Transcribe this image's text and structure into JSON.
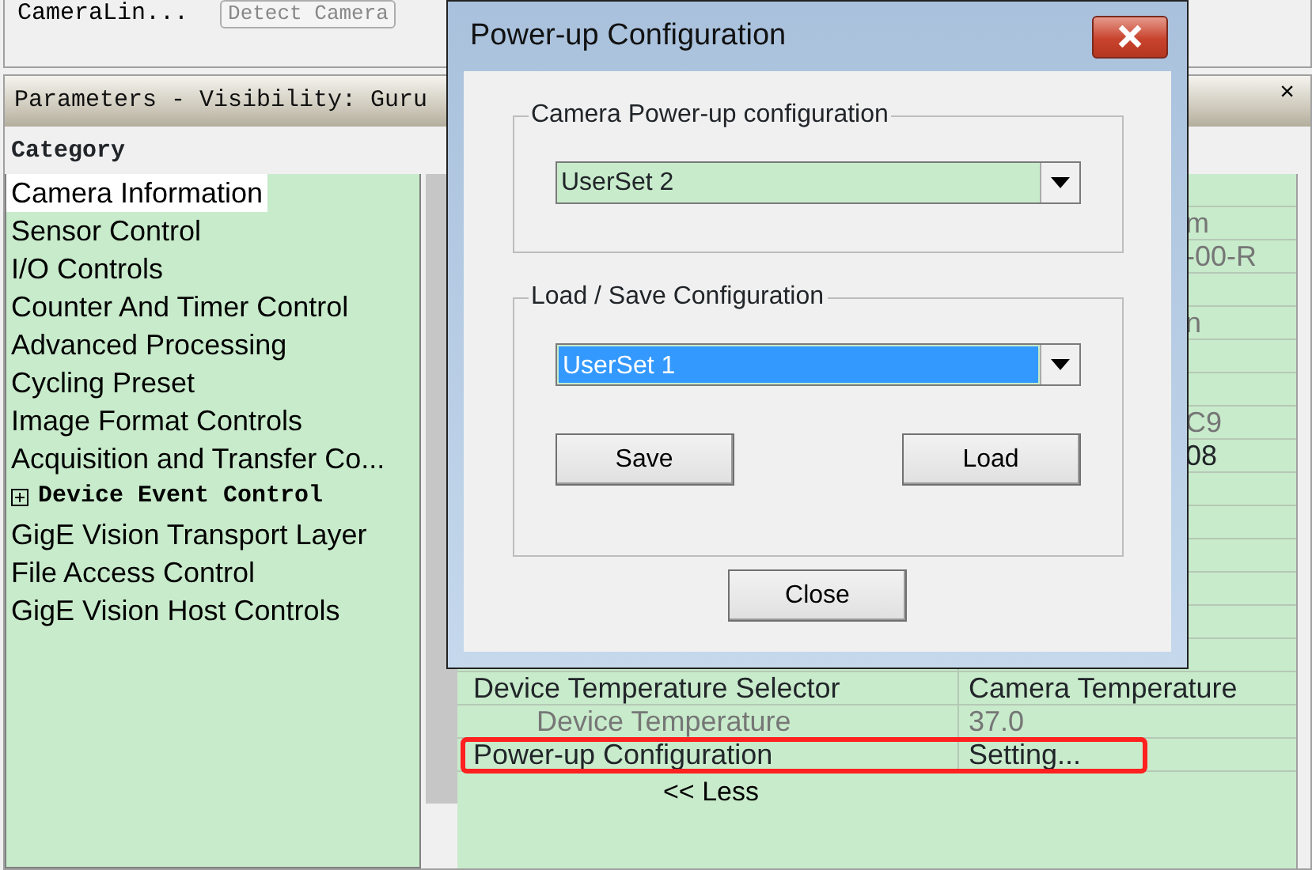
{
  "top_panel": {
    "label": "CameraLin...",
    "button": {
      "label": "Detect Camera",
      "disabled": true
    }
  },
  "parameters": {
    "title": "Parameters - Visibility: Guru",
    "close": "×",
    "category_header": "Category",
    "categories": [
      {
        "label": "Camera Information",
        "selected": true,
        "kind": "item"
      },
      {
        "label": "Sensor Control",
        "selected": false,
        "kind": "item"
      },
      {
        "label": "I/O Controls",
        "selected": false,
        "kind": "item"
      },
      {
        "label": "Counter And Timer Control",
        "selected": false,
        "kind": "item"
      },
      {
        "label": "Advanced Processing",
        "selected": false,
        "kind": "item"
      },
      {
        "label": "Cycling Preset",
        "selected": false,
        "kind": "item"
      },
      {
        "label": "Image Format Controls",
        "selected": false,
        "kind": "item"
      },
      {
        "label": "Acquisition and Transfer Co...",
        "selected": false,
        "kind": "item"
      },
      {
        "label": "Device Event Control",
        "selected": false,
        "kind": "group",
        "expanded": false
      },
      {
        "label": "GigE Vision Transport Layer",
        "selected": false,
        "kind": "item"
      },
      {
        "label": "File Access Control",
        "selected": false,
        "kind": "item"
      },
      {
        "label": "GigE Vision Host Controls",
        "selected": false,
        "kind": "item"
      }
    ],
    "covered_values": [
      {
        "value": "m",
        "readonly": true
      },
      {
        "value": "-00-R",
        "readonly": true
      },
      {
        "value": "n",
        "readonly": true
      },
      {
        "value": "C9",
        "readonly": true
      },
      {
        "value": "08",
        "readonly": false
      }
    ],
    "rows": [
      {
        "name": "Device Temperature Selector",
        "value": "Camera Temperature",
        "readonly": false,
        "highlighted": false,
        "children": [
          {
            "name": "Device Temperature",
            "value": "37.0",
            "readonly": true,
            "highlighted": false
          }
        ]
      },
      {
        "name": "Power-up Configuration",
        "value": "Setting...",
        "readonly": false,
        "highlighted": true
      }
    ],
    "less_link": "<< Less"
  },
  "dialog": {
    "title": "Power-up Configuration",
    "groups": [
      {
        "legend": "Camera Power-up configuration",
        "combo": {
          "value": "UserSet 2",
          "focused": false
        }
      },
      {
        "legend": "Load / Save Configuration",
        "combo": {
          "value": "UserSet 1",
          "focused": true
        },
        "buttons": [
          "Save",
          "Load"
        ]
      }
    ],
    "close_button": "Close"
  }
}
